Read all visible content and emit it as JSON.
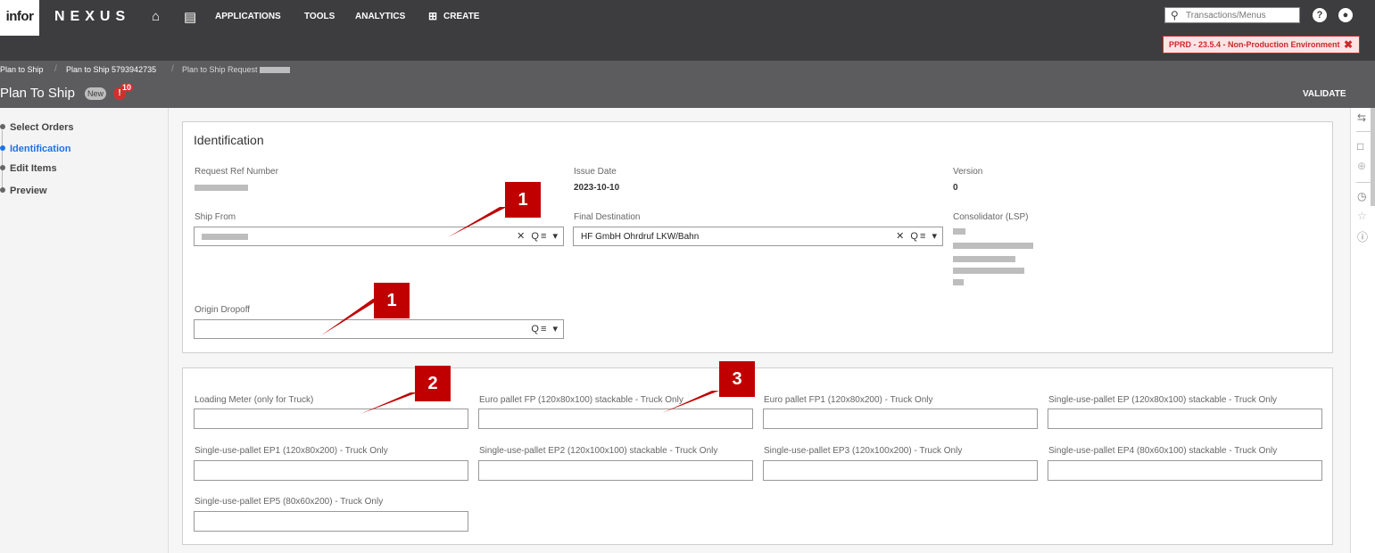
{
  "header": {
    "logo": "infor",
    "brand": "NEXUS",
    "nav": [
      "APPLICATIONS",
      "TOOLS",
      "ANALYTICS"
    ],
    "create_label": "CREATE",
    "search_placeholder": "Transactions/Menus",
    "env_badge": "PPRD - 23.5.4 - Non-Production Environment"
  },
  "breadcrumb": [
    "Plan to Ship",
    "Plan to Ship 5793942735",
    "Plan to Ship Request"
  ],
  "page": {
    "title": "Plan To Ship",
    "status": "New",
    "alert_count": "10",
    "validate_label": "VALIDATE"
  },
  "steps": [
    "Select Orders",
    "Identification",
    "Edit Items",
    "Preview"
  ],
  "active_step": "Identification",
  "identification": {
    "title": "Identification",
    "request_ref_label": "Request Ref Number",
    "issue_date_label": "Issue Date",
    "issue_date": "2023-10-10",
    "version_label": "Version",
    "version": "0",
    "ship_from_label": "Ship From",
    "final_destination_label": "Final Destination",
    "final_destination": "HF GmbH Ohrdruf LKW/Bahn",
    "consolidator_label": "Consolidator (LSP)",
    "origin_dropoff_label": "Origin Dropoff"
  },
  "loading": {
    "fields": [
      "Loading Meter (only for Truck)",
      "Euro pallet FP (120x80x100) stackable - Truck Only",
      "Euro pallet FP1 (120x80x200) - Truck Only",
      "Single-use-pallet EP (120x80x100) stackable - Truck Only",
      "Single-use-pallet EP1 (120x80x200) - Truck Only",
      "Single-use-pallet EP2 (120x100x100) stackable - Truck Only",
      "Single-use-pallet EP3 (120x100x200) - Truck Only",
      "Single-use-pallet EP4 (80x60x100) stackable - Truck Only",
      "Single-use-pallet EP5 (80x60x200) - Truck Only"
    ]
  },
  "annotations": [
    "1",
    "1",
    "2",
    "3"
  ],
  "colors": {
    "accent": "#1a73e8",
    "annotation": "#c00000",
    "topbar": "#3d3d3f",
    "env_badge": "#c92a2a"
  }
}
